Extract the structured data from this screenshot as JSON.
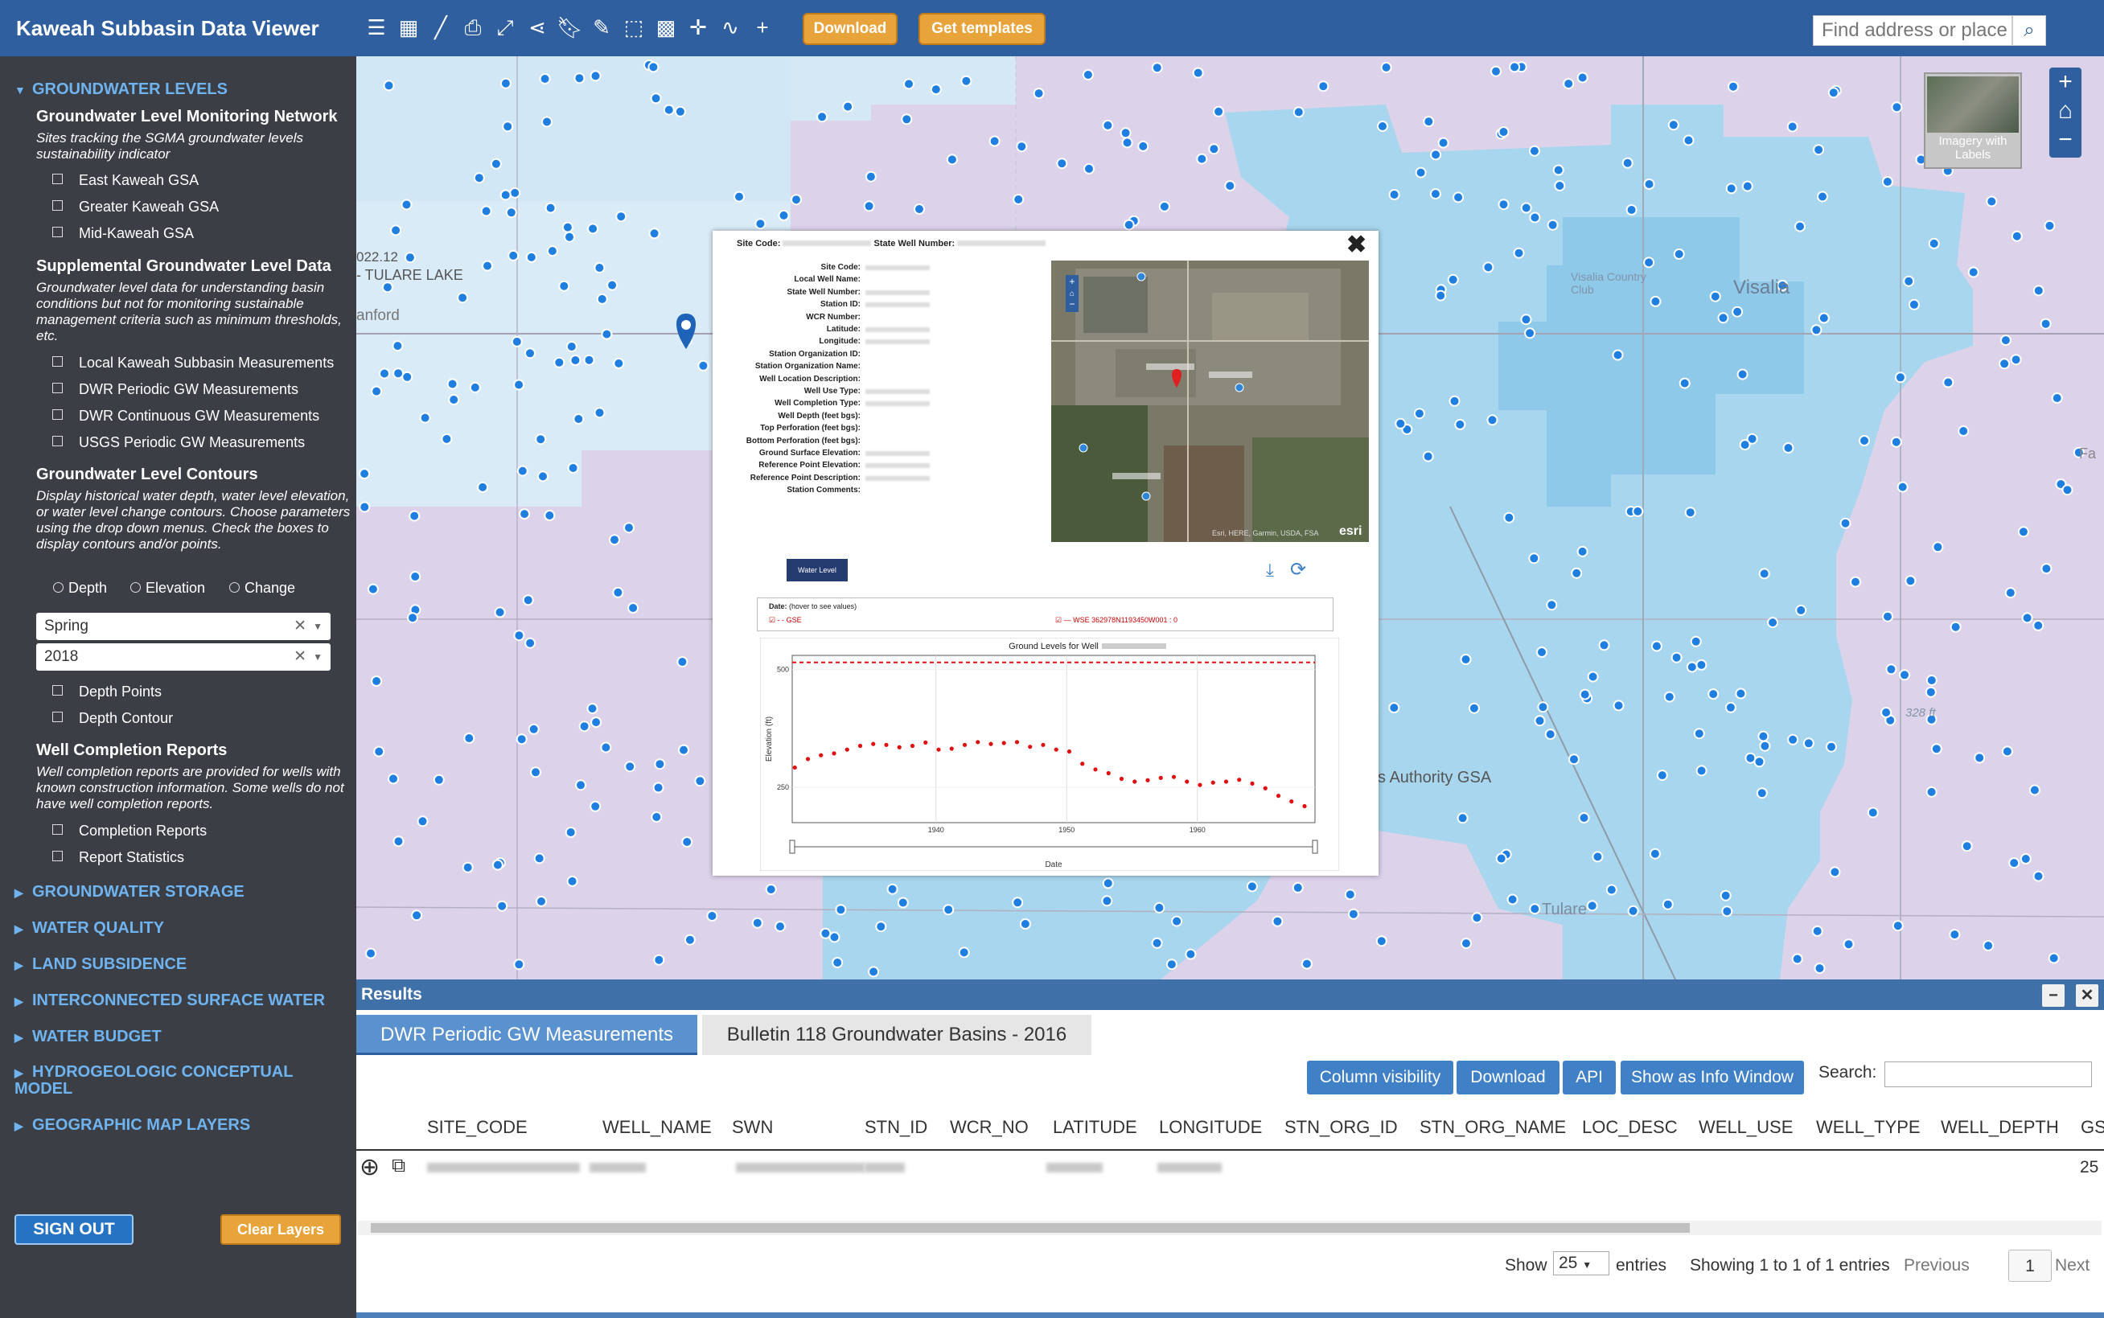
{
  "app": {
    "title": "Kaweah Subbasin Data Viewer"
  },
  "toolbar": {
    "download_label": "Download",
    "templates_label": "Get templates",
    "search_placeholder": "Find address or place",
    "icons": [
      "list-icon",
      "grid-icon",
      "measure-line-icon",
      "print-icon",
      "fullscreen-icon",
      "share-icon",
      "bookmark-icon",
      "draw-icon",
      "select-box-icon",
      "select-area-icon",
      "crosshair-icon",
      "polyline-icon",
      "plus-icon"
    ]
  },
  "sidebar": {
    "sections": [
      {
        "label": "GROUNDWATER LEVELS",
        "expanded": true
      },
      {
        "label": "GROUNDWATER STORAGE",
        "expanded": false
      },
      {
        "label": "WATER QUALITY",
        "expanded": false
      },
      {
        "label": "LAND SUBSIDENCE",
        "expanded": false
      },
      {
        "label": "INTERCONNECTED SURFACE WATER",
        "expanded": false
      },
      {
        "label": "WATER BUDGET",
        "expanded": false
      },
      {
        "label": "HYDROGEOLOGIC CONCEPTUAL MODEL",
        "expanded": false
      },
      {
        "label": "GEOGRAPHIC MAP LAYERS",
        "expanded": false
      }
    ],
    "gw_monitoring": {
      "title": "Groundwater Level Monitoring Network",
      "desc": "Sites tracking the SGMA groundwater levels sustainability indicator",
      "items": [
        "East Kaweah GSA",
        "Greater Kaweah GSA",
        "Mid-Kaweah GSA"
      ]
    },
    "supplemental": {
      "title": "Supplemental Groundwater Level Data",
      "desc": "Groundwater level data for understanding basin conditions but not for monitoring sustainable management criteria such as minimum thresholds, etc.",
      "items": [
        "Local Kaweah Subbasin Measurements",
        "DWR Periodic GW Measurements",
        "DWR Continuous GW Measurements",
        "USGS Periodic GW Measurements"
      ]
    },
    "contours": {
      "title": "Groundwater Level Contours",
      "desc": "Display historical water depth, water level elevation, or water level change contours. Choose parameters using the drop down menus. Check the boxes to display contours and/or points.",
      "radios": [
        "Depth",
        "Elevation",
        "Change"
      ],
      "season": "Spring",
      "year": "2018",
      "items": [
        "Depth Points",
        "Depth Contour"
      ]
    },
    "wcr": {
      "title": "Well Completion Reports",
      "desc": "Well completion reports are provided for wells with known construction information. Some wells do not have well completion reports.",
      "items": [
        "Completion Reports",
        "Report Statistics"
      ]
    },
    "signout_label": "SIGN OUT",
    "clear_label": "Clear Layers"
  },
  "map": {
    "labels": {
      "tulare_lake": "- TULARE LAKE",
      "year_frag": "022.12",
      "hanford": "anford",
      "visalia": "Visalia",
      "country_club": "Visalia Country Club",
      "authority": "s Authority GSA",
      "tulare": "Tulare",
      "elev_ft": "328 ft",
      "fa": "Fa"
    },
    "basemap_label": "Imagery with Labels",
    "zoom_in": "+",
    "zoom_out": "−"
  },
  "popup": {
    "site_code_label": "Site Code:",
    "state_well_label": "State Well Number:",
    "fields": [
      "Site Code:",
      "Local Well Name:",
      "State Well Number:",
      "Station ID:",
      "WCR Number:",
      "Latitude:",
      "Longitude:",
      "Station Organization ID:",
      "Station Organization Name:",
      "Well Location Description:",
      "Well Use Type:",
      "Well Completion Type:",
      "Well Depth (feet bgs):",
      "Top Perforation (feet bgs):",
      "Bottom Perforation (feet bgs):",
      "Ground Surface Elevation:",
      "Reference Point Elevation:",
      "Reference Point Description:",
      "Station Comments:"
    ],
    "sat_attribution": "Esri, HERE, Garmin, USDA, FSA",
    "esri": "esri",
    "water_level_btn": "Water Level",
    "legend": {
      "date_label": "Date:",
      "hover_hint": "(hover to see values)",
      "gse": "- - GSE",
      "wse": "— WSE 362978N1193450W001 : 0"
    }
  },
  "chart_data": {
    "type": "scatter",
    "title": "Ground Levels for Well",
    "xlabel": "Date",
    "ylabel": "Elevation (ft)",
    "xlim": [
      1929,
      1969
    ],
    "ylim": [
      175,
      530
    ],
    "x_ticks": [
      1940,
      1950,
      1960
    ],
    "y_ticks": [
      250,
      500
    ],
    "gse_value": 515,
    "series": [
      {
        "name": "GSE",
        "style": "dashed",
        "color": "#e01010",
        "x": [
          1929,
          1969
        ],
        "y": [
          515,
          515
        ]
      },
      {
        "name": "WSE",
        "style": "points",
        "color": "#e01010",
        "x": [
          1929.2,
          1930.2,
          1931.2,
          1932.2,
          1933.2,
          1934.2,
          1935.2,
          1936.2,
          1937.2,
          1938.2,
          1939.2,
          1940.2,
          1941.2,
          1942.2,
          1943.2,
          1944.2,
          1945.2,
          1946.2,
          1947.2,
          1948.2,
          1949.2,
          1950.2,
          1951.2,
          1952.2,
          1953.2,
          1954.2,
          1955.2,
          1956.2,
          1957.2,
          1958.2,
          1959.2,
          1960.2,
          1961.2,
          1962.2,
          1963.2,
          1964.2,
          1965.2,
          1966.2,
          1967.2,
          1968.2
        ],
        "y": [
          292,
          310,
          318,
          322,
          330,
          338,
          342,
          340,
          335,
          338,
          345,
          330,
          332,
          340,
          346,
          342,
          344,
          346,
          336,
          340,
          330,
          326,
          300,
          288,
          280,
          268,
          262,
          265,
          270,
          272,
          262,
          255,
          260,
          262,
          266,
          258,
          248,
          232,
          220,
          210
        ]
      }
    ]
  },
  "results": {
    "title": "Results",
    "tabs": [
      "DWR Periodic GW Measurements",
      "Bulletin 118 Groundwater Basins - 2016"
    ],
    "buttons": [
      "Column visibility",
      "Download",
      "API",
      "Show as Info Window"
    ],
    "search_label": "Search:",
    "columns": [
      "SITE_CODE",
      "WELL_NAME",
      "SWN",
      "STN_ID",
      "WCR_NO",
      "LATITUDE",
      "LONGITUDE",
      "STN_ORG_ID",
      "STN_ORG_NAME",
      "LOC_DESC",
      "WELL_USE",
      "WELL_TYPE",
      "WELL_DEPTH",
      "GS"
    ],
    "row_tail": "25",
    "show_label": "Show",
    "page_size": "25",
    "entries_label": "entries",
    "info": "Showing 1 to 1 of 1 entries",
    "prev": "Previous",
    "page": "1",
    "next": "Next"
  }
}
